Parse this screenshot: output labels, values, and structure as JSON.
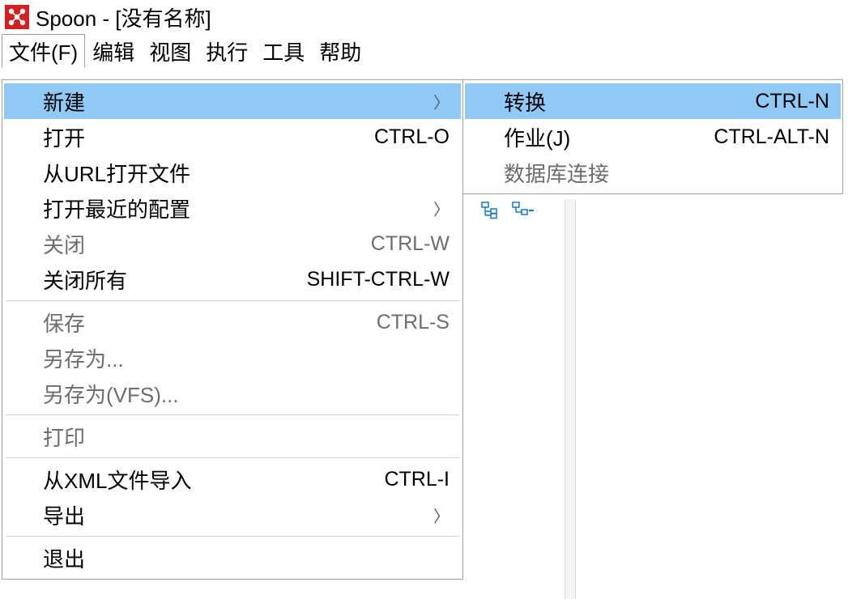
{
  "title": "Spoon - [没有名称]",
  "menu_bar": {
    "file": "文件(F)",
    "edit": "编辑",
    "view": "视图",
    "run": "执行",
    "tools": "工具",
    "help": "帮助"
  },
  "file_menu": {
    "new": {
      "label": "新建"
    },
    "open": {
      "label": "打开",
      "shortcut": "CTRL-O"
    },
    "open_url": {
      "label": "从URL打开文件"
    },
    "open_recent": {
      "label": "打开最近的配置"
    },
    "close": {
      "label": "关闭",
      "shortcut": "CTRL-W"
    },
    "close_all": {
      "label": "关闭所有",
      "shortcut": "SHIFT-CTRL-W"
    },
    "save": {
      "label": "保存",
      "shortcut": "CTRL-S"
    },
    "save_as": {
      "label": "另存为..."
    },
    "save_as_vfs": {
      "label": "另存为(VFS)..."
    },
    "print": {
      "label": "打印"
    },
    "import_xml": {
      "label": "从XML文件导入",
      "shortcut": "CTRL-I"
    },
    "export": {
      "label": "导出"
    },
    "exit": {
      "label": "退出"
    }
  },
  "new_submenu": {
    "transformation": {
      "label": "转换",
      "shortcut": "CTRL-N"
    },
    "job": {
      "label": "作业(J)",
      "shortcut": "CTRL-ALT-N"
    },
    "db_connection": {
      "label": "数据库连接"
    }
  }
}
